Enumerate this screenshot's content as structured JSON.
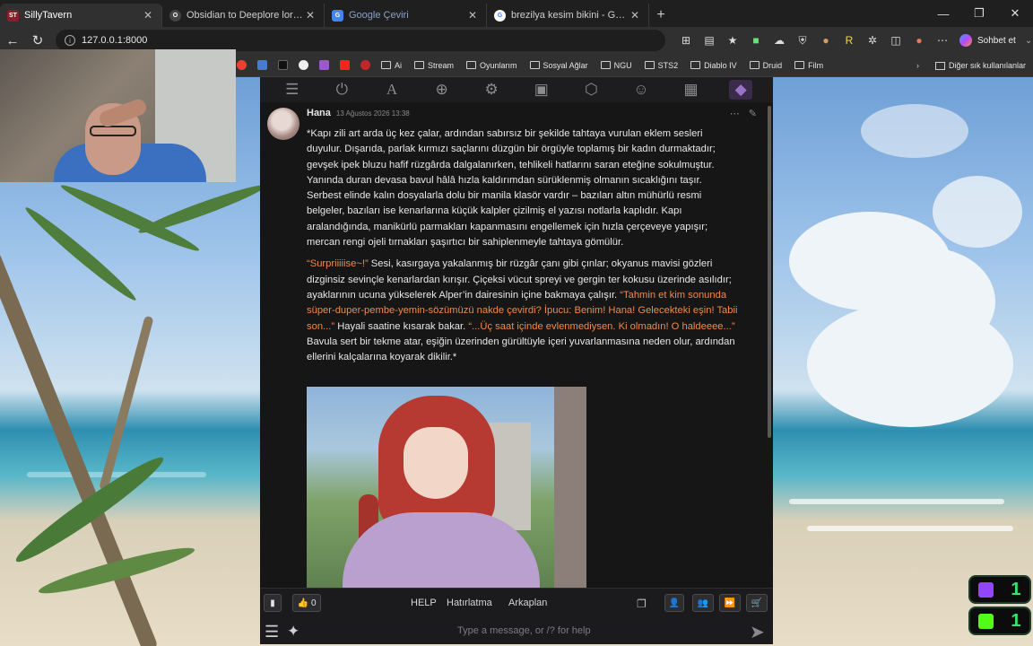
{
  "browser": {
    "tabs": [
      {
        "title": "SillyTavern",
        "favicon_text": "ST",
        "favicon_color": "#8b1e2b",
        "active": true
      },
      {
        "title": "Obsidian to Deeplore lore convers",
        "favicon_text": "O",
        "favicon_color": "#333333",
        "active": false
      },
      {
        "title": "Google Çeviri",
        "favicon_text": "G",
        "favicon_color": "#4285f4",
        "active": false
      },
      {
        "title": "brezilya kesim bikini - Google'da A",
        "favicon_text": "G",
        "favicon_color": "#ffffff",
        "active": false
      }
    ],
    "url": "127.0.0.1:8000",
    "copilot_label": "Sohbet et",
    "bookmarks": [
      "Ai",
      "Stream",
      "Oyunlarım",
      "Sosyal Ağlar",
      "NGU",
      "STS2",
      "Diablo IV",
      "Druid",
      "Film"
    ],
    "other_bookmarks": "Diğer sık kullanılanlar"
  },
  "message": {
    "name": "Hana",
    "time": "13 Ağustos 2026 13:38",
    "p1": "*Kapı zili art arda üç kez çalar, ardından sabırsız bir şekilde tahtaya vurulan eklem sesleri duyulur. Dışarıda, parlak kırmızı saçlarını düzgün bir örgüyle toplamış bir kadın durmaktadır; gevşek ipek bluzu hafif rüzgârda dalgalanırken, tehlikeli hatlarını saran eteğine sokulmuştur. Yanında duran devasa bavul hâlâ hızla kaldırımdan sürüklenmiş olmanın sıcaklığını taşır. Serbest elinde kalın dosyalarla dolu bir manila klasör vardır – bazıları altın mühürlü resmi belgeler, bazıları ise kenarlarına küçük kalpler çizilmiş el yazısı notlarla kaplıdır. Kapı aralandığında, manikürlü parmakları kapanmasını engellemek için hızla çerçeveye yapışır; mercan rengi ojeli tırnakları şaşırtıcı bir sahiplenmeyle tahtaya gömülür.",
    "q1": "“Surpriiiiise~!”",
    "t1": " Sesi, kasırgaya yakalanmış bir rüzgâr çanı gibi çınlar; okyanus mavisi gözleri dizginsiz sevinçle kenarlardan kırışır. Çiçeksi vücut spreyi ve gergin ter kokusu üzerinde asılıdır; ayaklarının ucuna yükselerek Alper’in dairesinin içine bakmaya çalışır. ",
    "q2": "“Tahmin et kim sonunda süper-duper-pembe-yemin-sözümüzü nakde çevirdi? İpucu: Benim! Hana! Gelecekteki eşin! Tabii son...”",
    "t2": " Hayali saatine kısarak bakar. ",
    "q3": "“...Üç saat içinde evlenmediysen. Ki olmadın! O haldeeee...”",
    "t3": " Bavula sert bir tekme atar, eşiğin üzerinden gürültüyle içeri yuvarlanmasına neden olur, ardından ellerini kalçalarına koyarak dikilir.*"
  },
  "bottom": {
    "token_count": "0",
    "quick_replies": [
      "HELP",
      "Hatırlatma",
      "Arkaplan"
    ],
    "input_placeholder": "Type a message, or /? for help"
  },
  "overlay": {
    "twitch_count": "1",
    "kick_count": "1"
  },
  "colors": {
    "quote": "#ef8a4a",
    "accent": "#9b74c7",
    "counter": "#38e36d"
  }
}
